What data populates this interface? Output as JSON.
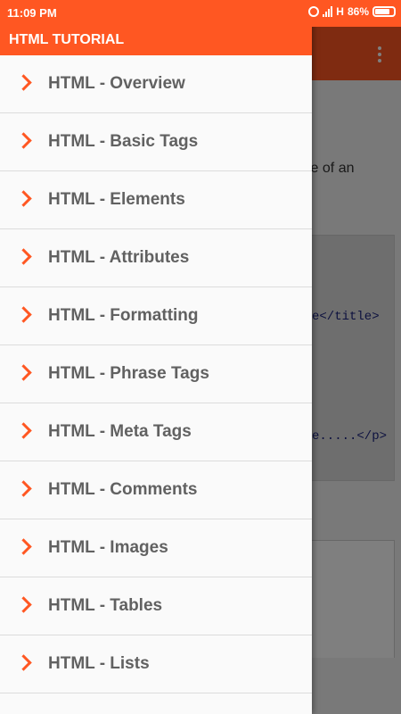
{
  "status_bar": {
    "time": "11:09 PM",
    "network_label": "H",
    "battery_percent": "86%"
  },
  "drawer": {
    "title": "HTML TUTORIAL",
    "items": [
      {
        "label": "HTML - Overview"
      },
      {
        "label": "HTML - Basic Tags"
      },
      {
        "label": "HTML - Elements"
      },
      {
        "label": "HTML - Attributes"
      },
      {
        "label": "HTML - Formatting"
      },
      {
        "label": "HTML - Phrase Tags"
      },
      {
        "label": "HTML - Meta Tags"
      },
      {
        "label": "HTML - Comments"
      },
      {
        "label": "HTML - Images"
      },
      {
        "label": "HTML - Tables"
      },
      {
        "label": "HTML - Lists"
      }
    ]
  },
  "background_content": {
    "text_fragment": "le of an",
    "code_line_1": "e</title>",
    "code_line_2": "e.....</p>"
  },
  "colors": {
    "accent": "#ff5722",
    "text_menu": "#616161"
  }
}
